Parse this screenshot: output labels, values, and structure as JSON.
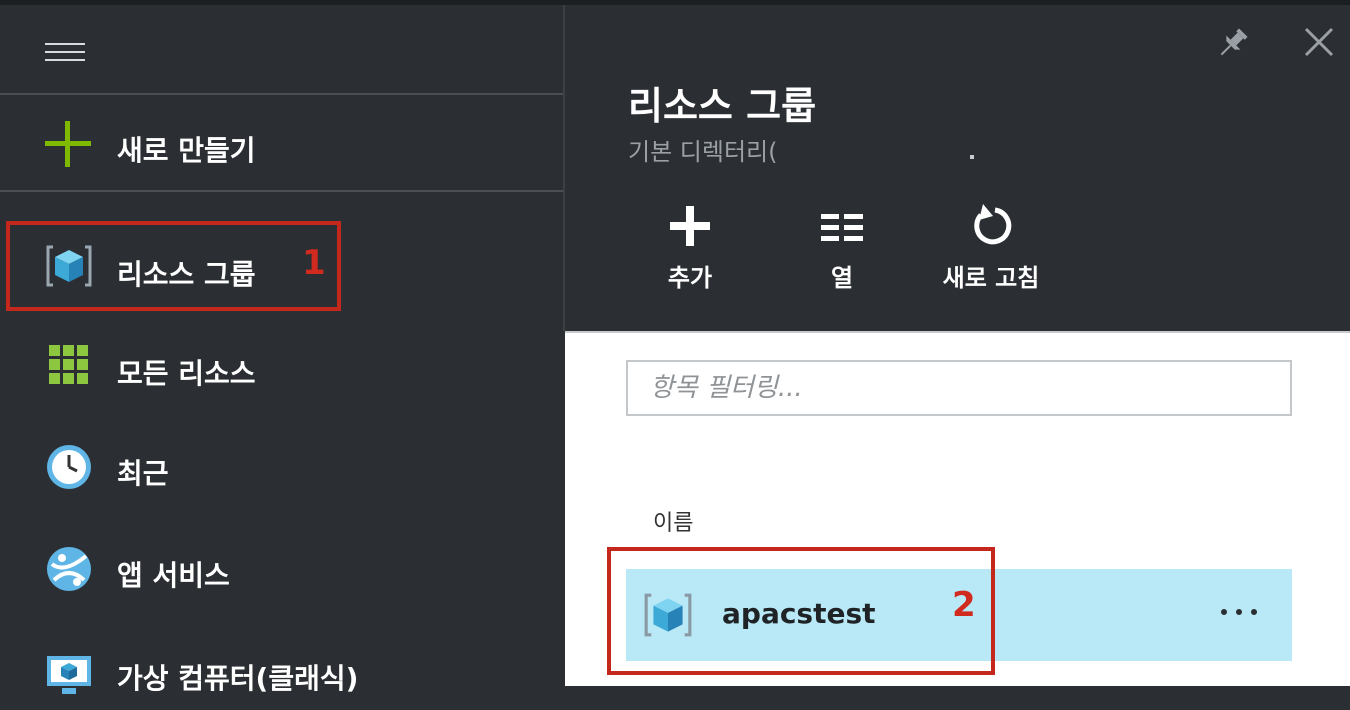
{
  "sidebar": {
    "create_label": "새로 만들기",
    "items": [
      {
        "label": "리소스 그룹",
        "icon": "resource-group-icon"
      },
      {
        "label": "모든 리소스",
        "icon": "all-resources-icon"
      },
      {
        "label": "최근",
        "icon": "clock-icon"
      },
      {
        "label": "앱 서비스",
        "icon": "app-service-icon"
      },
      {
        "label": "가상 컴퓨터(클래식)",
        "icon": "virtual-machine-icon"
      }
    ]
  },
  "blade": {
    "title": "리소스 그룹",
    "subtitle": "기본 디렉터리(",
    "toolbar": {
      "add_label": "추가",
      "columns_label": "열",
      "refresh_label": "새로 고침"
    },
    "filter_placeholder": "항목 필터링...",
    "column_name_header": "이름",
    "rows": [
      {
        "name": "apacstest",
        "more_label": "..."
      }
    ]
  },
  "annotations": {
    "marker_1": "1",
    "marker_2": "2"
  },
  "colors": {
    "sidebar_bg": "#2b2f33",
    "accent_green": "#7fba00",
    "annotation_red": "#c4271c",
    "selected_row_bg": "#b9e9f7"
  }
}
